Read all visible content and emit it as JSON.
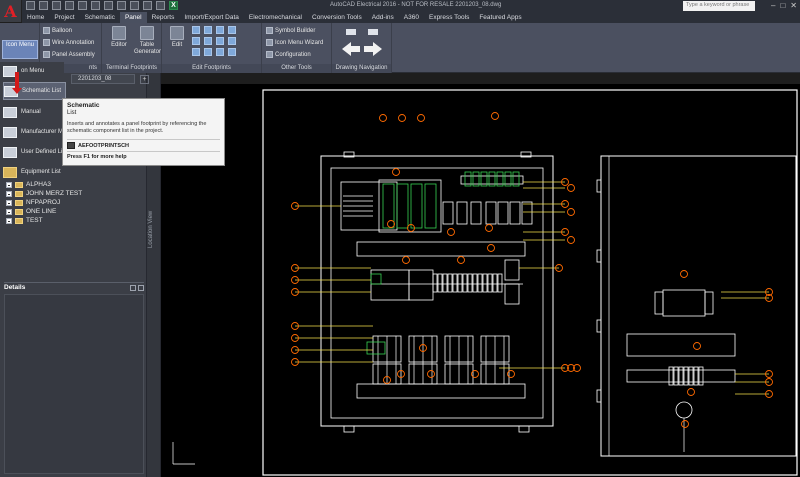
{
  "app": {
    "logo_letter": "A",
    "window_title": "AutoCAD Electrical 2016 - NOT FOR RESALE  2201203_08.dwg",
    "search_placeholder": "Type a keyword or phrase",
    "window_controls": [
      "–",
      "□",
      "✕"
    ]
  },
  "ribbon_tabs": [
    {
      "label": "Home"
    },
    {
      "label": "Project"
    },
    {
      "label": "Schematic"
    },
    {
      "label": "Panel",
      "active": true
    },
    {
      "label": "Reports"
    },
    {
      "label": "Import/Export Data"
    },
    {
      "label": "Electromechanical"
    },
    {
      "label": "Conversion Tools"
    },
    {
      "label": "Add-ins"
    },
    {
      "label": "A360"
    },
    {
      "label": "Express Tools"
    },
    {
      "label": "Featured Apps"
    }
  ],
  "ribbon": {
    "icon_menu_label": "Icon Menu",
    "balloon": "Balloon",
    "wire_annotation": "Wire Annotation",
    "panel_assembly": "Panel Assembly",
    "editor": "Editor",
    "table_generator": "Table Generator",
    "edit": "Edit",
    "symbol_builder": "Symbol Builder",
    "icon_menu_wizard": "Icon Menu Wizard",
    "configuration": "Configuration",
    "panels": {
      "insert": "nts",
      "terminal_footprints": "Terminal Footprints",
      "edit_footprints": "Edit Footprints",
      "other_tools": "Other Tools",
      "drawing_navigation": "Drawing Navigation"
    }
  },
  "icon_menu_items": [
    {
      "label": "on Menu"
    },
    {
      "label": "Schematic List",
      "active": true
    },
    {
      "label": "Manual"
    },
    {
      "label": "Manufacturer M"
    },
    {
      "label": "User Defined Lis"
    },
    {
      "label": "Equipment List"
    }
  ],
  "drawing_tab": "2201203_08",
  "project_tree": [
    {
      "label": "ALPHA3"
    },
    {
      "label": "JOHN MERZ TEST"
    },
    {
      "label": "NFPAPROJ"
    },
    {
      "label": "ONE LINE"
    },
    {
      "label": "TEST"
    }
  ],
  "location_view_label": "Location View",
  "details_label": "Details",
  "tooltip": {
    "title": "Schematic",
    "subtitle": "List",
    "description": "Inserts and annotates a panel footprint by referencing the schematic component list in the project.",
    "command": "AEFOOTPRINTSCH",
    "help": "Press F1 for more help"
  },
  "drawing": {
    "line_color": "#ffffff",
    "accent_green": "#39d353",
    "balloon_color": "#ff6a00",
    "wire_color": "#f4e04d"
  }
}
